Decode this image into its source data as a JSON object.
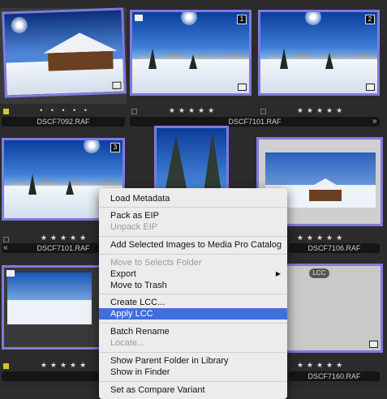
{
  "thumbnails": [
    {
      "badge": ""
    },
    {
      "badge": "1"
    },
    {
      "badge": "2"
    },
    {
      "badge": "3"
    }
  ],
  "captions": {
    "row1_left": "DSCF7092.RAF",
    "row1_mid": "DSCF7101.RAF",
    "row2_left": "DSCF7101.RAF",
    "row2_right": "DSCF7106.RAF",
    "row3_right": "DSCF7160.RAF"
  },
  "ratings": {
    "stars": "★★★★★",
    "dots": "• • • • •"
  },
  "lcc_badge": "LCC",
  "context_menu": {
    "items": [
      "Load Metadata",
      "Pack as EIP",
      "Unpack EIP",
      "Add Selected Images to Media Pro Catalog",
      "Move to Selects Folder",
      "Export",
      "Move to Trash",
      "Create LCC...",
      "Apply LCC",
      "Batch Rename",
      "Locate...",
      "Show Parent Folder in Library",
      "Show in Finder",
      "Set as Compare Variant"
    ],
    "submenu_arrow": "▶",
    "highlighted": "Apply LCC"
  },
  "colors": {
    "selection": "#7f7bdc",
    "menu_highlight": "#3f6fdc",
    "color_tag": "#d7c82a"
  }
}
